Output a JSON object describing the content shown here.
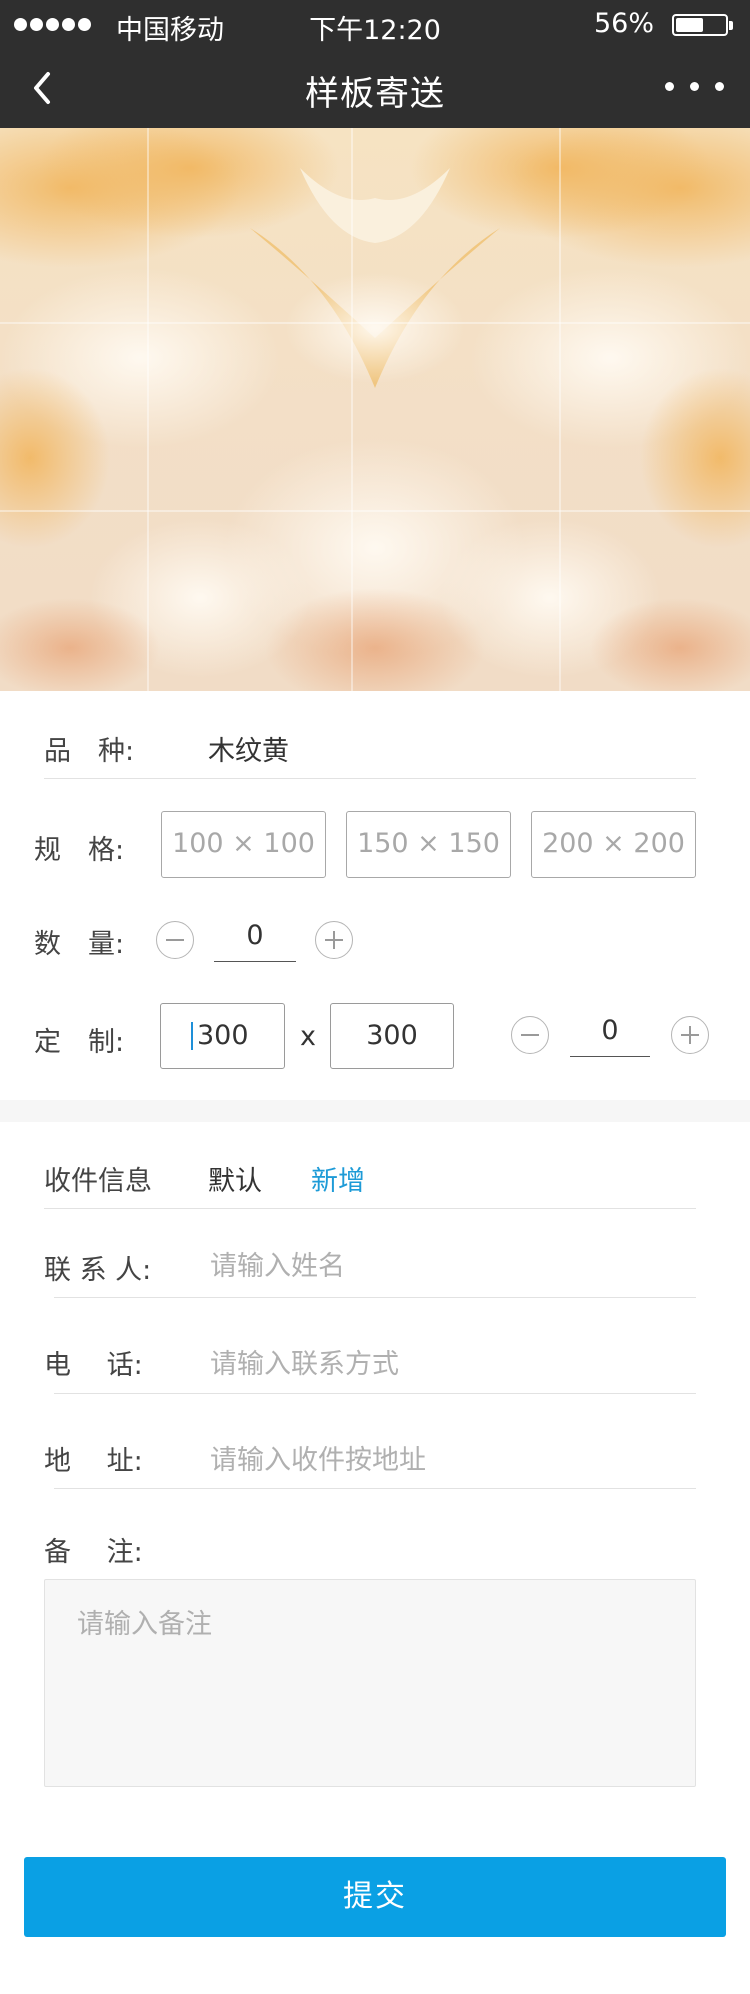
{
  "status": {
    "carrier": "中国移动",
    "time": "下午12:20",
    "battery_pct": "56%",
    "battery_level": 0.56
  },
  "nav": {
    "title": "样板寄送",
    "back_icon": "chevron-left-icon",
    "more_icon": "more-dots-icon"
  },
  "product": {
    "variety_label": "品　种:",
    "variety_value": "木纹黄",
    "spec_label": "规　格:",
    "spec_options": [
      "100 × 100",
      "150 × 150",
      "200 × 200"
    ],
    "qty_label": "数　量:",
    "qty_value": "0",
    "custom_label": "定　制:",
    "custom_width": "300",
    "custom_sep": "x",
    "custom_height": "300",
    "custom_qty": "0"
  },
  "recipient": {
    "section_label": "收件信息",
    "tab_default": "默认",
    "tab_new": "新增",
    "contact_label": "联 系 人:",
    "contact_placeholder": "请输入姓名",
    "phone_label": "电　 话:",
    "phone_placeholder": "请输入联系方式",
    "address_label": "地　 址:",
    "address_placeholder": "请输入收件按地址",
    "remark_label": "备　 注:",
    "remark_placeholder": "请输入备注"
  },
  "submit_label": "提交",
  "colors": {
    "accent": "#0aa0e4",
    "link": "#1e9bd7",
    "navbar": "#2f2f2f"
  }
}
